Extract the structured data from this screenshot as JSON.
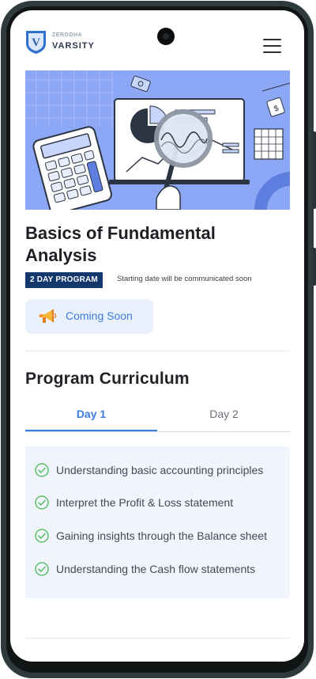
{
  "brand": {
    "small_text": "ZERODHA",
    "name": "VARSITY"
  },
  "program": {
    "title": "Basics of Fundamental Analysis",
    "badge": "2 DAY PROGRAM",
    "start_note": "Starting date will be communicated soon",
    "status_button": "Coming Soon"
  },
  "curriculum": {
    "heading": "Program Curriculum",
    "tabs": [
      {
        "label": "Day 1",
        "active": true
      },
      {
        "label": "Day 2",
        "active": false
      }
    ],
    "items": [
      "Understanding basic accounting principles",
      "Interpret the Profit & Loss statement",
      "Gaining insights through the Balance sheet",
      "Understanding the Cash flow statements"
    ]
  },
  "colors": {
    "accent_blue": "#3c7be0",
    "badge_navy": "#13386e",
    "hero_bg": "#8da7f7",
    "check_green": "#5cbf6b"
  },
  "icons": {
    "menu": "hamburger-menu-icon",
    "status": "megaphone-icon",
    "item": "check-circle-icon"
  }
}
